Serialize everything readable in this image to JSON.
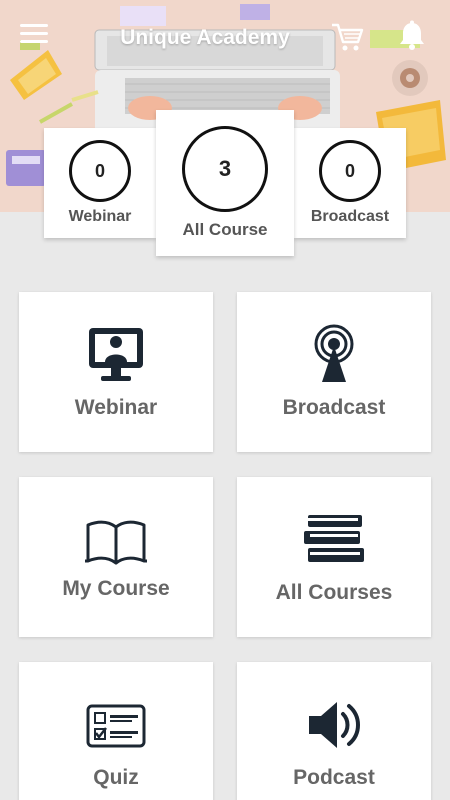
{
  "header": {
    "title": "Unique Academy",
    "menu_icon": "hamburger-menu-icon",
    "cart_icon": "cart-icon",
    "bell_icon": "bell-icon"
  },
  "stats": {
    "webinar": {
      "count": "0",
      "label": "Webinar"
    },
    "all_course": {
      "count": "3",
      "label": "All Course"
    },
    "broadcast": {
      "count": "0",
      "label": "Broadcast"
    }
  },
  "tiles": [
    {
      "label": "Webinar",
      "icon": "monitor-presenter-icon"
    },
    {
      "label": "Broadcast",
      "icon": "broadcast-tower-icon"
    },
    {
      "label": "My Course",
      "icon": "open-book-icon"
    },
    {
      "label": "All Courses",
      "icon": "book-stack-icon"
    },
    {
      "label": "Quiz",
      "icon": "quiz-checklist-icon"
    },
    {
      "label": "Podcast",
      "icon": "speaker-icon"
    }
  ],
  "colors": {
    "banner_bg": "#f1d7cb",
    "page_bg": "#e9e9e9",
    "icon_dark": "#1c2733",
    "label_gray": "#666666"
  }
}
